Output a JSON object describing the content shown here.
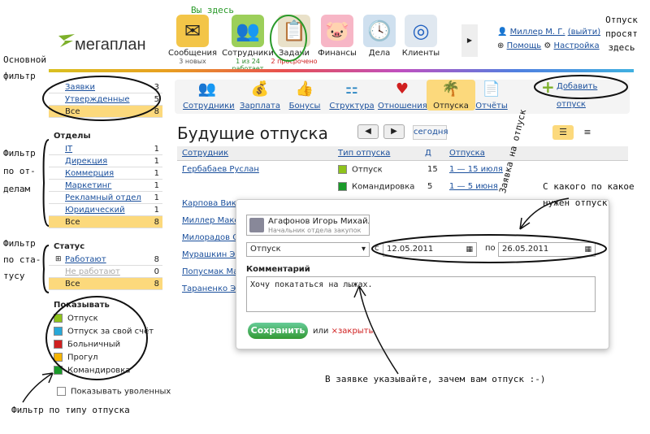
{
  "annot": {
    "here": "Вы здесь",
    "asked": "Отпуск\nпросят\nздесь",
    "main_filter": "Основной\nфильтр",
    "dept_filter": "Фильтр\nпо от-\nделам",
    "status_filter": "Фильтр\nпо ста-\nтусу",
    "type_filter": "Фильтр по типу отпуска",
    "request": "Заявка на отпуск",
    "period": "С какого по какое\nнужен отпуск",
    "reason": "В заявке указывайте, зачем вам отпуск :-)"
  },
  "logo": "мегаплан",
  "nav": [
    {
      "label": "Сообщения",
      "sub": "3 новых",
      "icon": "✉",
      "color": "#f3c548"
    },
    {
      "label": "Сотрудники",
      "sub": "1 из 24 работает",
      "icon": "👥",
      "color": "#9ccf5a"
    },
    {
      "label": "Задачи",
      "sub": "2 просрочено",
      "icon": "📋",
      "color": "#e9e1c9"
    },
    {
      "label": "Финансы",
      "sub": "",
      "icon": "🐷",
      "color": "#f7b6c6"
    },
    {
      "label": "Дела",
      "sub": "",
      "icon": "🕓",
      "color": "#cfe0ef"
    },
    {
      "label": "Клиенты",
      "sub": "",
      "icon": "◎",
      "color": "#e0e8f0"
    }
  ],
  "user": {
    "name": "Миллер М. Г.",
    "logout": "(выйти)",
    "help": "Помощь",
    "settings": "Настройка"
  },
  "main_filter": [
    {
      "label": "Заявки",
      "n": "3"
    },
    {
      "label": "Утвержденные",
      "n": "5"
    },
    {
      "label": "Все",
      "n": "8"
    }
  ],
  "depts_title": "Отделы",
  "depts": [
    {
      "label": "IT",
      "n": "1"
    },
    {
      "label": "Дирекция",
      "n": "1"
    },
    {
      "label": "Коммерция",
      "n": "1"
    },
    {
      "label": "Маркетинг",
      "n": "1"
    },
    {
      "label": "Рекламный отдел",
      "n": "1"
    },
    {
      "label": "Юридический",
      "n": "1"
    },
    {
      "label": "Все",
      "n": "8"
    }
  ],
  "status_title": "Статус",
  "status": [
    {
      "label": "Работают",
      "n": "8"
    },
    {
      "label": "Не работают",
      "n": "0"
    },
    {
      "label": "Все",
      "n": "8"
    }
  ],
  "show_title": "Показывать",
  "types": [
    {
      "label": "Отпуск",
      "color": "#8ec31b"
    },
    {
      "label": "Отпуск за свой счёт",
      "color": "#28a8d8"
    },
    {
      "label": "Больничный",
      "color": "#d02020"
    },
    {
      "label": "Прогул",
      "color": "#f5b400"
    },
    {
      "label": "Командировка",
      "color": "#1a9a2a"
    }
  ],
  "show_fired": "Показывать уволенных",
  "tabs": [
    {
      "label": "Сотрудники",
      "icon": "👥"
    },
    {
      "label": "Зарплата",
      "icon": "💰"
    },
    {
      "label": "Бонусы",
      "icon": "👍"
    },
    {
      "label": "Структура",
      "icon": "⚏"
    },
    {
      "label": "Отношения",
      "icon": "♥"
    },
    {
      "label": "Отпуска",
      "icon": "🌴"
    },
    {
      "label": "Отчёты",
      "icon": "📄"
    }
  ],
  "add_leave": "Добавить отпуск",
  "page_title": "Будущие отпуска",
  "prev": "◀",
  "next": "▶",
  "today": "сегодня",
  "table": {
    "cols": [
      "Сотрудник",
      "Тип отпуска",
      "Д",
      "Отпуска"
    ],
    "rows": [
      {
        "name": "Гербабаев Руслан",
        "type": "Отпуск",
        "tcolor": "#8ec31b",
        "d": "15",
        "dates": "1 — 15 июля"
      },
      {
        "name": "",
        "type": "Командировка",
        "tcolor": "#1a9a2a",
        "d": "5",
        "dates": "1 — 5 июня"
      }
    ],
    "names": [
      "Карпова Викто",
      "Миллер Макси",
      "Милорадов Ол",
      "Мурашкин Эду",
      "Попусмак Мар",
      "Тараненко Эду"
    ]
  },
  "modal": {
    "person": "Агафонов Игорь Михайло",
    "position": "Начальник отдела закупок",
    "type": "Отпуск",
    "from_label": "с",
    "from": "12.05.2011",
    "to_label": "по",
    "to": "26.05.2011",
    "comment_label": "Комментарий",
    "comment": "Хочу покататься на лыжах.",
    "save": "Сохранить",
    "or": "или",
    "close": "закрыть"
  }
}
